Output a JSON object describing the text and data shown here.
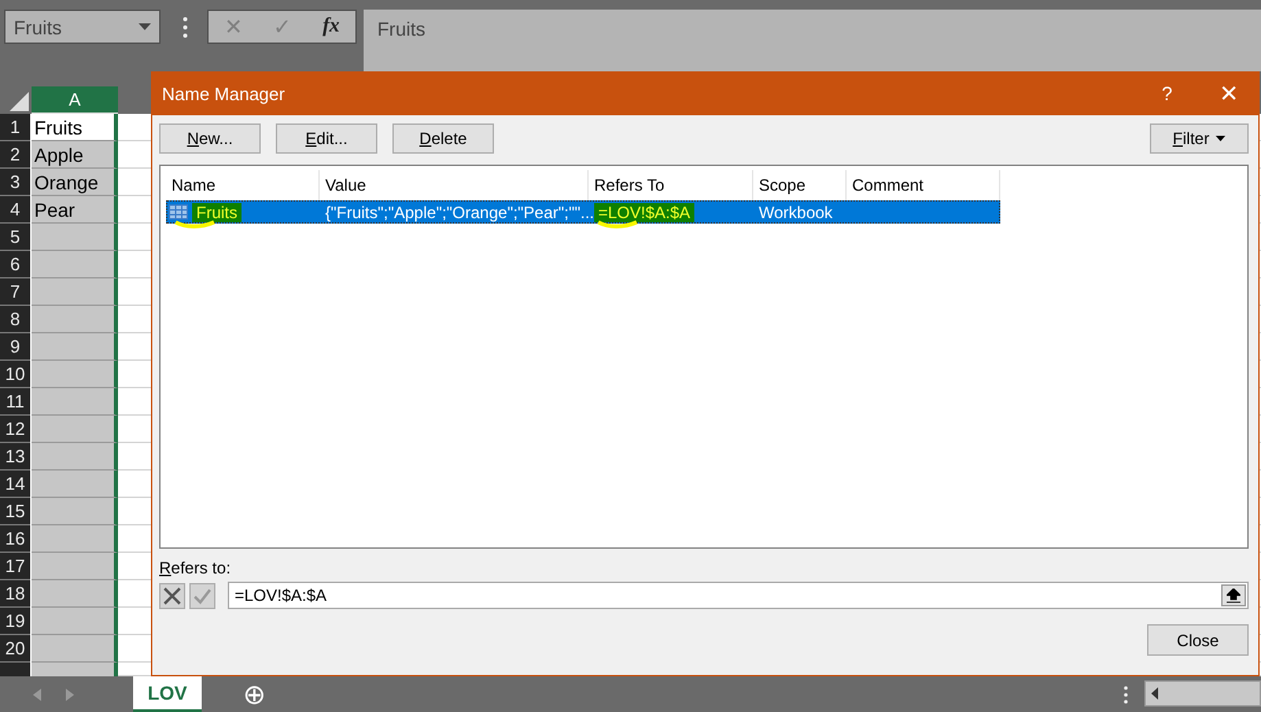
{
  "formula_bar": {
    "name_box": "Fruits",
    "cancel": "✕",
    "enter": "✓",
    "fx": "fx",
    "formula": "Fruits"
  },
  "sheet": {
    "columns": [
      {
        "label": "A",
        "selected": true
      }
    ],
    "rows": [
      {
        "number": "1",
        "cell": "Fruits",
        "active": true
      },
      {
        "number": "2",
        "cell": "Apple",
        "active": false
      },
      {
        "number": "3",
        "cell": "Orange",
        "active": false
      },
      {
        "number": "4",
        "cell": "Pear",
        "active": false
      },
      {
        "number": "5",
        "active": false
      },
      {
        "number": "6",
        "active": false
      },
      {
        "number": "7",
        "active": false
      },
      {
        "number": "8",
        "active": false
      },
      {
        "number": "9",
        "active": false
      },
      {
        "number": "10",
        "active": false
      },
      {
        "number": "11",
        "active": false
      },
      {
        "number": "12",
        "active": false
      },
      {
        "number": "13",
        "active": false
      },
      {
        "number": "14",
        "active": false
      },
      {
        "number": "15",
        "active": false
      },
      {
        "number": "16",
        "active": false
      },
      {
        "number": "17",
        "active": false
      },
      {
        "number": "18",
        "active": false
      },
      {
        "number": "19",
        "active": false
      },
      {
        "number": "20",
        "active": false
      }
    ]
  },
  "name_manager": {
    "title": "Name Manager",
    "help": "?",
    "close_glyph": "✕",
    "buttons": [
      {
        "label": "New...",
        "mnemonic": true
      },
      {
        "label": "Edit...",
        "mnemonic": true
      },
      {
        "label": "Delete",
        "mnemonic": true
      }
    ],
    "filter": {
      "label": "Filter",
      "mnemonic": true
    },
    "columns": [
      "Name",
      "Value",
      "Refers To",
      "Scope",
      "Comment"
    ],
    "names": [
      {
        "selected": true,
        "cells": [
          {
            "text": "Fruits",
            "highlighted": true
          },
          {
            "text": "{\"Fruits\";\"Apple\";\"Orange\";\"Pear\";\"\"...",
            "highlighted": false
          },
          {
            "text": "=LOV!$A:$A",
            "highlighted": true
          },
          {
            "text": "Workbook",
            "highlighted": false
          }
        ]
      }
    ],
    "refers_to_label": {
      "label": "Refers to:",
      "mnemonic": true
    },
    "refers_to_value": "=LOV!$A:$A",
    "close_button": "Close"
  },
  "sheet_tabs": [
    {
      "label": "LOV",
      "selected": true
    }
  ],
  "add_sheet": "⊕"
}
